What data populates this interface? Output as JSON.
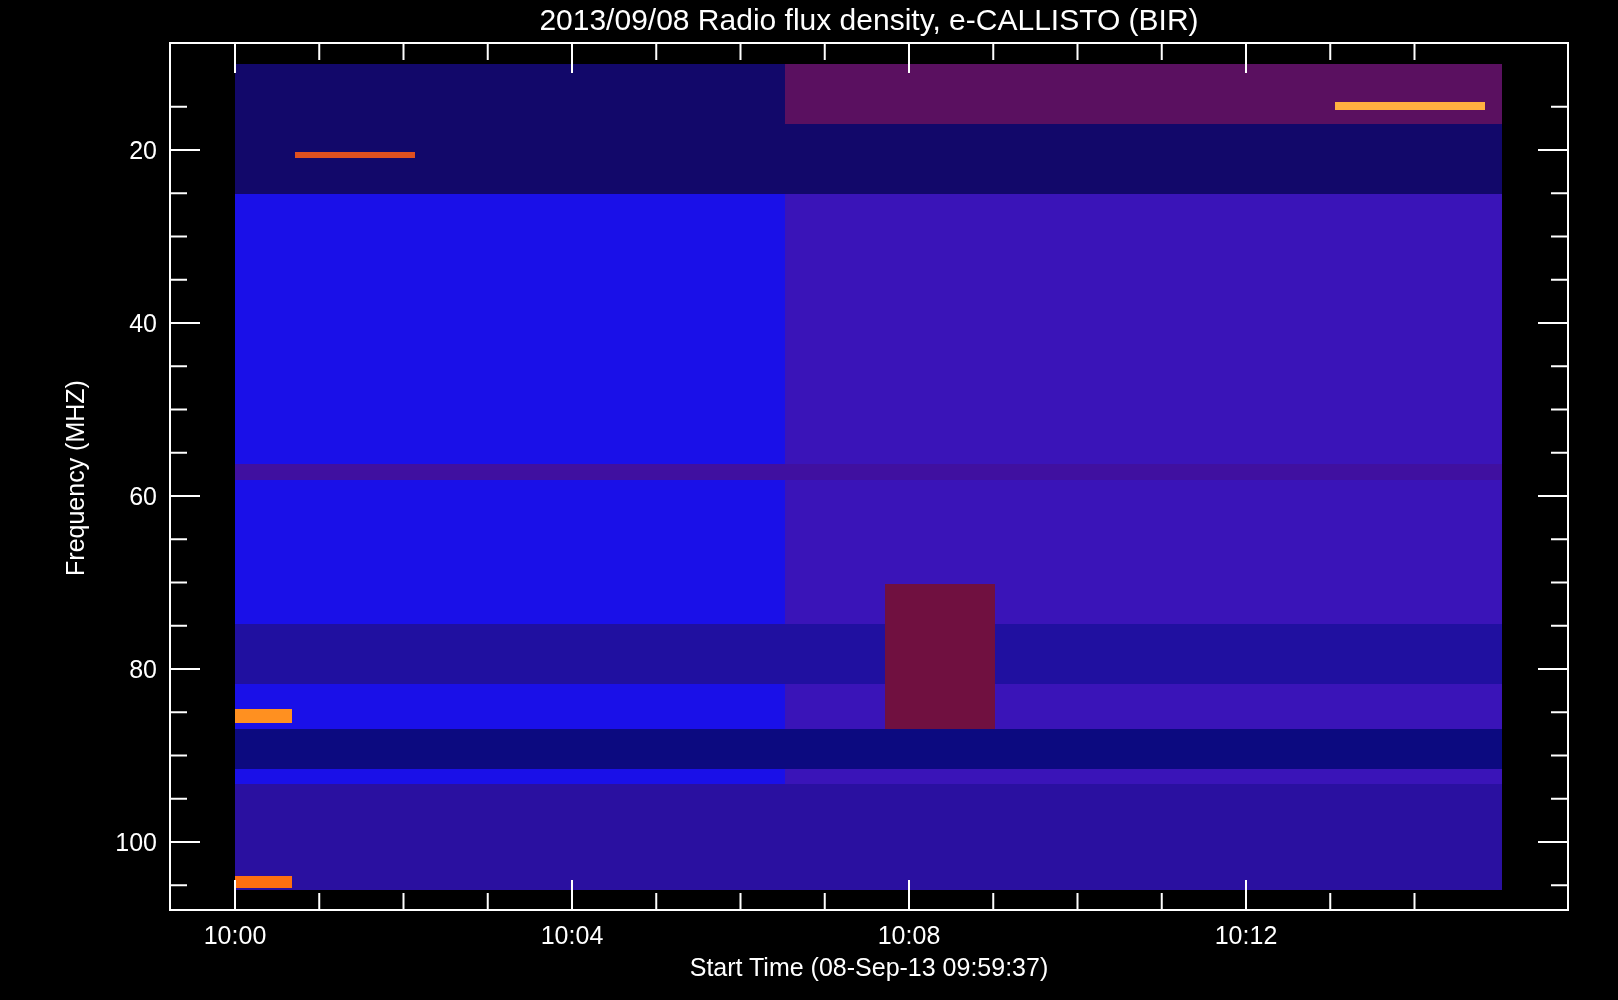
{
  "title": "2013/09/08  Radio flux density, e-CALLISTO (BIR)",
  "x_axis": {
    "label": "Start Time (08-Sep-13 09:59:37)",
    "ticks": [
      "10:00",
      "10:04",
      "10:08",
      "10:12"
    ]
  },
  "y_axis": {
    "label": "Frequency (MHZ)",
    "ticks": [
      "20",
      "40",
      "60",
      "80",
      "100"
    ]
  }
}
